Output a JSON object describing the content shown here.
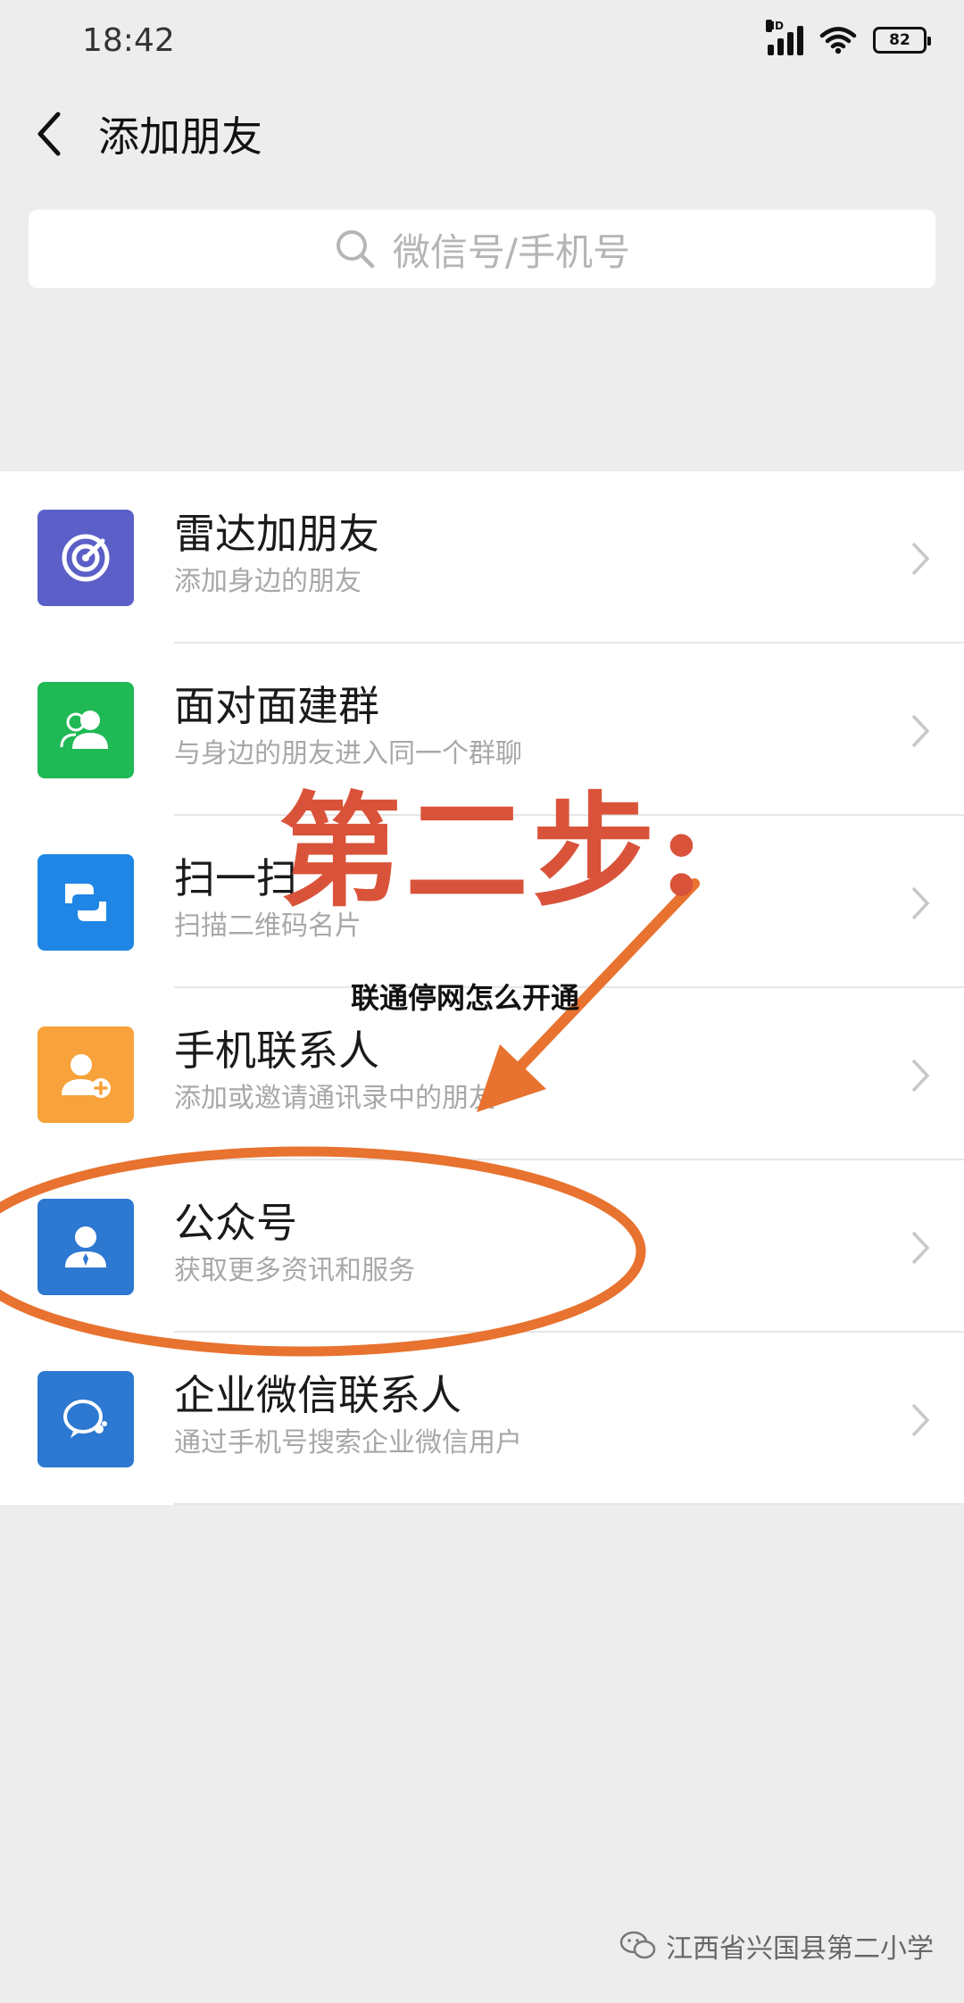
{
  "status_bar": {
    "time": "18:42",
    "signal_label": "HD",
    "battery_level": "82"
  },
  "header": {
    "title": "添加朋友",
    "back_icon": "chevron-left-icon"
  },
  "search": {
    "placeholder": "微信号/手机号",
    "icon": "search-icon"
  },
  "items": [
    {
      "title": "雷达加朋友",
      "subtitle": "添加身边的朋友",
      "icon": "radar-icon",
      "color": "#5b5fc7"
    },
    {
      "title": "面对面建群",
      "subtitle": "与身边的朋友进入同一个群聊",
      "icon": "group-icon",
      "color": "#1fb955"
    },
    {
      "title": "扫一扫",
      "subtitle": "扫描二维码名片",
      "icon": "scan-icon",
      "color": "#1f86e5"
    },
    {
      "title": "手机联系人",
      "subtitle": "添加或邀请通讯录中的朋友",
      "icon": "contacts-icon",
      "color": "#f7a23a"
    },
    {
      "title": "公众号",
      "subtitle": "获取更多资讯和服务",
      "icon": "official-account-icon",
      "color": "#2d78d1"
    },
    {
      "title": "企业微信联系人",
      "subtitle": "通过手机号搜索企业微信用户",
      "icon": "work-wechat-icon",
      "color": "#2d78d1"
    }
  ],
  "annotation": {
    "step_text": "第二步:",
    "caption": "联通停网怎么开通",
    "accent_color": "#e8722f",
    "step_color": "#d9533a"
  },
  "watermark": {
    "text": "江西省兴国县第二小学",
    "icon": "wechat-logo-icon"
  }
}
